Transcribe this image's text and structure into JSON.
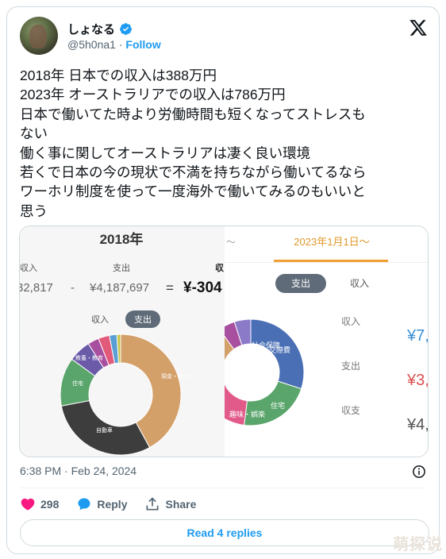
{
  "author": {
    "display_name": "しょなる",
    "handle": "@5h0na1",
    "separator": "·",
    "follow_label": "Follow"
  },
  "tweet": {
    "lines": [
      "2018年 日本での収入は388万円",
      "2023年 オーストラリアでの収入は786万円",
      "日本で働いてた時より労働時間も短くなってストレスも",
      "ない",
      "働く事に関してオーストラリアは凄く良い環境",
      "若くで日本の今の現状で不満を持ちながら働いてるなら",
      "ワーホリ制度を使って一度海外で働いてみるのもいいと",
      "思う"
    ]
  },
  "media": {
    "left": {
      "year_title": "2018年",
      "col_income": "収入",
      "col_expense": "支出",
      "col_balance": "収",
      "income_value": "32,817",
      "minus": "-",
      "expense_value": "¥4,187,697",
      "equals": "=",
      "balance_value": "¥-304",
      "toggle_income": "収入",
      "toggle_expense": "支出",
      "slice_labels": {
        "education": "教養・教育",
        "housing": "住宅",
        "car": "自動車",
        "cash_card": "現金・カード"
      },
      "chart_data": {
        "type": "pie",
        "series": [
          {
            "label": "現金・カード",
            "value": 42,
            "color": "#d4a06a"
          },
          {
            "label": "自動車",
            "value": 30,
            "color": "#3d3d3d"
          },
          {
            "label": "住宅",
            "value": 13,
            "color": "#5aa56b"
          },
          {
            "label": "教養・教育",
            "value": 6,
            "color": "#6a5aa8"
          },
          {
            "label": "",
            "value": 3,
            "color": "#a84fa0"
          },
          {
            "label": "",
            "value": 3,
            "color": "#e25a7a"
          },
          {
            "label": "",
            "value": 2,
            "color": "#5a9fd4"
          },
          {
            "label": "",
            "value": 1,
            "color": "#c7c34a"
          }
        ]
      }
    },
    "right": {
      "date_range": "2023年1月1日〜",
      "arrow_left": "〜",
      "toggle_expense": "支出",
      "toggle_income": "収入",
      "row1_label": "収入",
      "row1_value": "¥7,",
      "row2_label": "支出",
      "row2_value": "¥3,",
      "row3_label": "収支",
      "row3_value": "¥4,",
      "slice_labels": {
        "social": "社会保障",
        "transport": "交際費",
        "housing": "住宅",
        "hobby": "趣味・娯楽"
      },
      "chart_data": {
        "type": "pie",
        "series": [
          {
            "label": "交際費",
            "value": 30,
            "color": "#4a6fb5"
          },
          {
            "label": "住宅",
            "value": 22,
            "color": "#5aa56b"
          },
          {
            "label": "趣味・娯楽",
            "value": 18,
            "color": "#e25a8a"
          },
          {
            "label": "",
            "value": 10,
            "color": "#e8a0b0"
          },
          {
            "label": "社会保障",
            "value": 10,
            "color": "#d4a06a"
          },
          {
            "label": "",
            "value": 5,
            "color": "#a84fa0"
          },
          {
            "label": "",
            "value": 5,
            "color": "#8a7ac8"
          }
        ]
      }
    }
  },
  "meta": {
    "timestamp": "6:38 PM · Feb 24, 2024"
  },
  "actions": {
    "likes": "298",
    "reply_label": "Reply",
    "share_label": "Share"
  },
  "replies_button": "Read 4 replies",
  "watermark": "萌探说",
  "colors": {
    "brand_blue": "#1d9bf0",
    "like_pink": "#f91880",
    "accent_orange": "#f0a030"
  }
}
